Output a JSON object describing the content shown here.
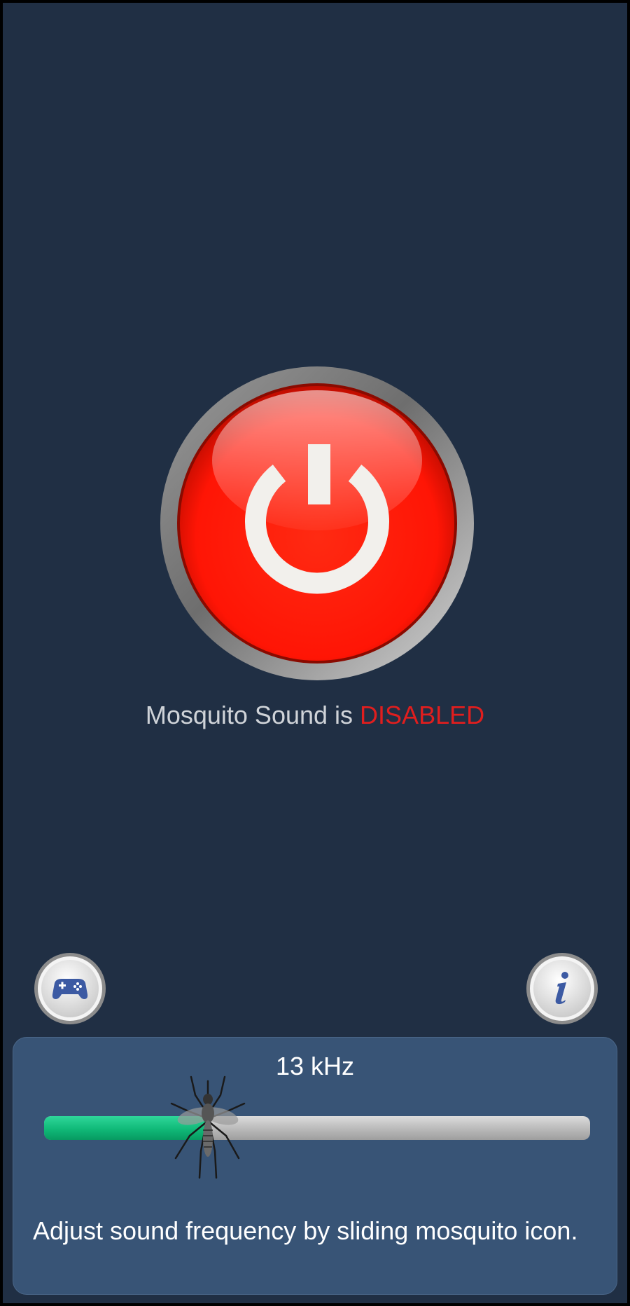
{
  "main": {
    "power_button": {
      "icon": "power-icon",
      "color": "#ff1a0a"
    },
    "status": {
      "prefix": "Mosquito Sound is",
      "state": "DISABLED",
      "state_color": "#e01e1e"
    }
  },
  "buttons": {
    "games": {
      "icon": "gamepad-icon"
    },
    "info": {
      "icon": "info-icon"
    }
  },
  "frequency_panel": {
    "frequency_label": "13 kHz",
    "slider": {
      "value_fraction": 0.3,
      "thumb_icon": "mosquito-icon"
    },
    "hint": "Adjust sound frequency by sliding mosquito icon."
  }
}
